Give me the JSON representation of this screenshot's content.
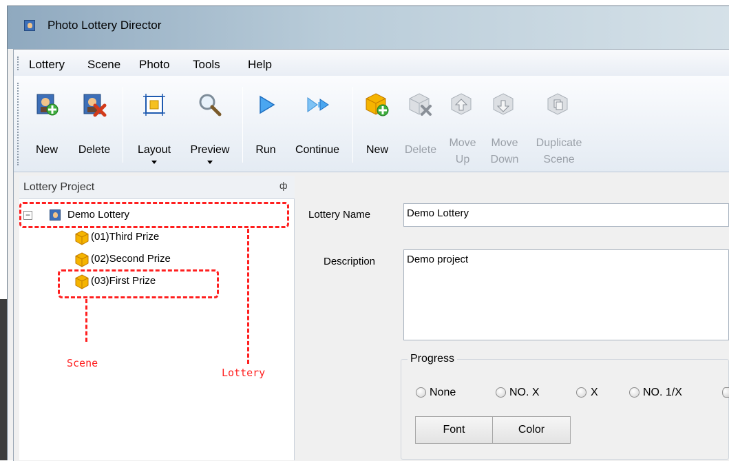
{
  "window": {
    "title": "Photo Lottery Director"
  },
  "menu": {
    "items": [
      "Lottery",
      "Scene",
      "Photo",
      "Tools",
      "Help"
    ]
  },
  "toolbar": {
    "new_lottery": "New",
    "delete_lottery": "Delete",
    "layout": "Layout",
    "preview": "Preview",
    "run": "Run",
    "continue": "Continue",
    "new_scene": "New",
    "delete_scene": "Delete",
    "move_up_1": "Move",
    "move_up_2": "Up",
    "move_down_1": "Move",
    "move_down_2": "Down",
    "duplicate_1": "Duplicate",
    "duplicate_2": "Scene"
  },
  "panel": {
    "title": "Lottery Project",
    "pin": "ф"
  },
  "tree": {
    "root": "Demo Lottery",
    "toggle": "−",
    "children": [
      "(01)Third Prize",
      "(02)Second Prize",
      "(03)First Prize"
    ]
  },
  "annotations": {
    "scene": "Scene",
    "lottery": "Lottery"
  },
  "form": {
    "name_label": "Lottery Name",
    "name_value": "Demo Lottery",
    "desc_label": "Description",
    "desc_value": "Demo project",
    "progress_title": "Progress",
    "radios": [
      "None",
      "NO. X",
      "X",
      "NO. 1/X"
    ],
    "font_button": "Font",
    "color_button": "Color"
  },
  "colors": {
    "annotation": "#ff1f1f",
    "toolbar_blue": "#2f8fe0"
  }
}
